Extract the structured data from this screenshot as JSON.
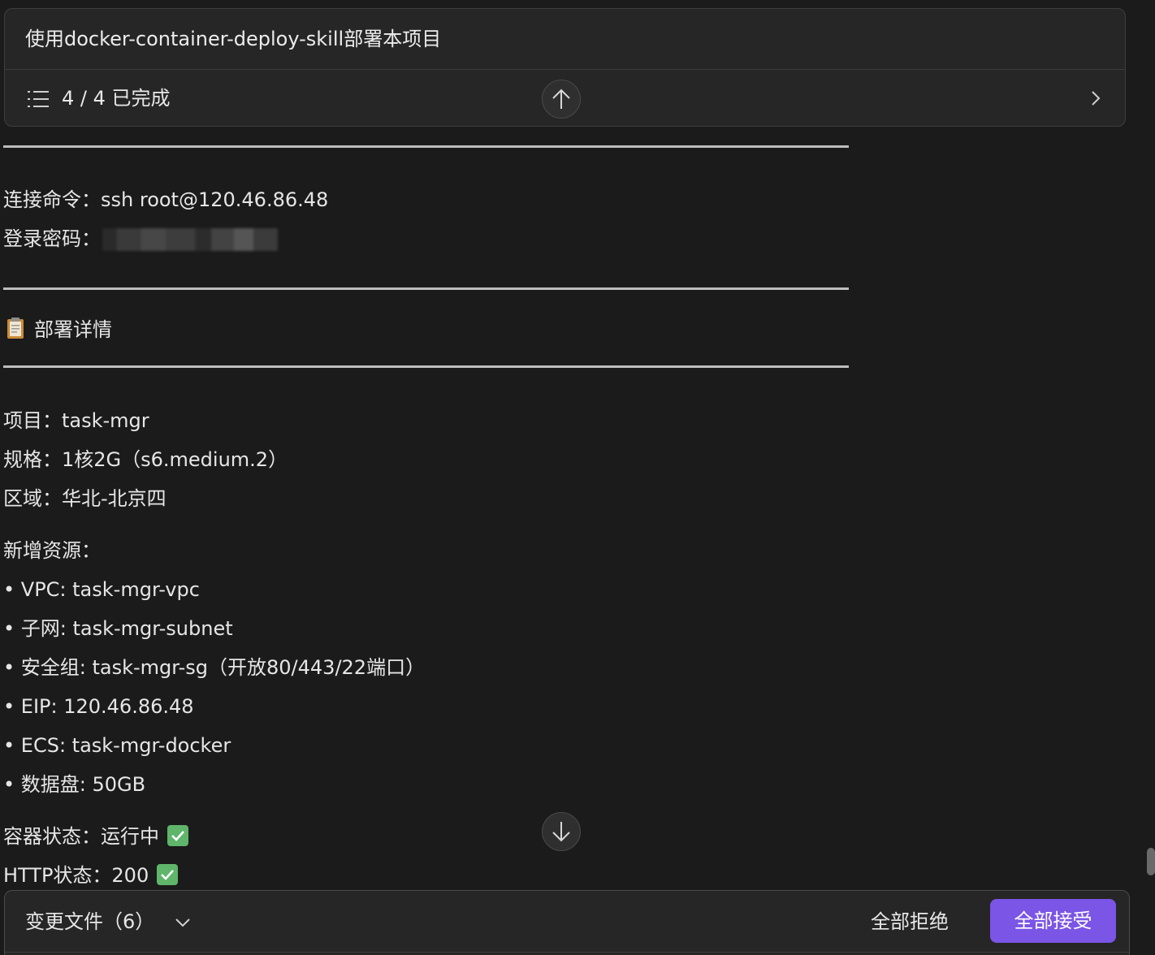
{
  "task": {
    "title": "使用docker-container-deploy-skill部署本项目",
    "progress": "4 / 4 已完成"
  },
  "connection": {
    "command_label": "连接命令：",
    "command_value": "ssh root@120.46.86.48",
    "password_label": "登录密码："
  },
  "details_heading": "部署详情",
  "details": {
    "project": "项目：task-mgr",
    "spec": "规格：1核2G（s6.medium.2）",
    "region": "区域：华北-北京四"
  },
  "resources": {
    "heading": "新增资源：",
    "items": [
      "• VPC: task-mgr-vpc",
      "• 子网: task-mgr-subnet",
      "• 安全组: task-mgr-sg（开放80/443/22端口）",
      "• EIP: 120.46.86.48",
      "• ECS: task-mgr-docker",
      "• 数据盘: 50GB"
    ]
  },
  "status": {
    "container": "容器状态：运行中",
    "http": "HTTP状态：200"
  },
  "bottom_bar": {
    "changes_label": "变更文件（6）",
    "reject_all": "全部拒绝",
    "accept_all": "全部接受"
  },
  "colors": {
    "background": "#1b1b1b",
    "card": "#262626",
    "accent": "#7a55e6",
    "check": "#5fb56a"
  },
  "icons": {
    "list": "list-icon",
    "chevron_right": "chevron-right-icon",
    "arrow_up": "arrow-up-icon",
    "arrow_down": "arrow-down-icon",
    "clipboard": "clipboard-icon",
    "check": "check-mark-icon",
    "chevron_down": "chevron-down-icon"
  }
}
